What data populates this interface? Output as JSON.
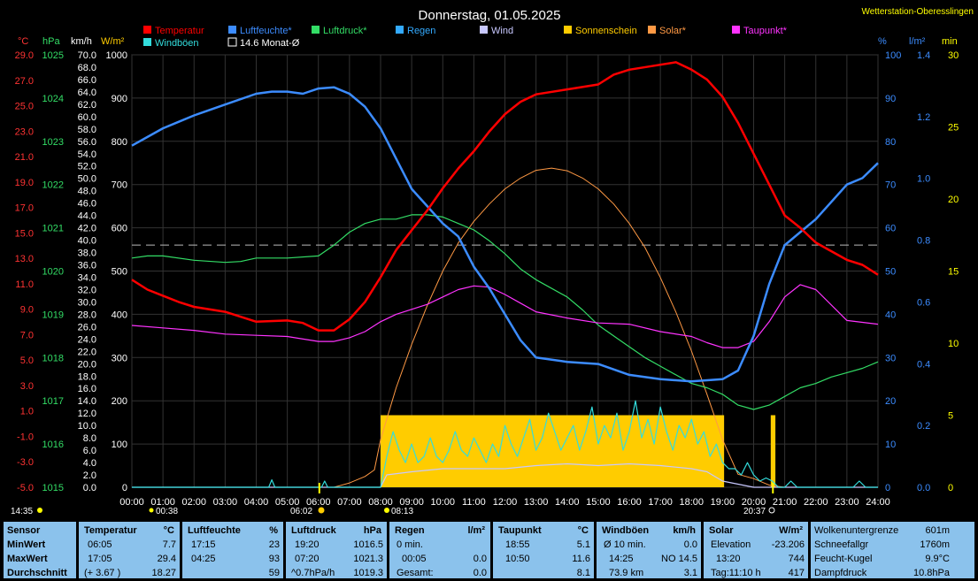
{
  "title": "Donnerstag, 01.05.2025",
  "station": "Wetterstation-Oberesslingen",
  "axes": {
    "left_units": [
      "°C",
      "hPa",
      "km/h",
      "W/m²"
    ],
    "right_units": [
      "%",
      "l/m²",
      "min"
    ],
    "temp_ticks": [
      "29.0",
      "27.0",
      "25.0",
      "23.0",
      "21.0",
      "19.0",
      "17.0",
      "15.0",
      "13.0",
      "11.0",
      "9.0",
      "7.0",
      "5.0",
      "3.0",
      "1.0",
      "-1.0",
      "-3.0",
      "-5.0"
    ],
    "hpa_ticks": [
      "1025",
      "1024",
      "1023",
      "1022",
      "1021",
      "1020",
      "1019",
      "1018",
      "1017",
      "1016",
      "1015"
    ],
    "kmh_ticks": [
      "70.0",
      "68.0",
      "66.0",
      "64.0",
      "62.0",
      "60.0",
      "58.0",
      "56.0",
      "54.0",
      "52.0",
      "50.0",
      "48.0",
      "46.0",
      "44.0",
      "42.0",
      "40.0",
      "38.0",
      "36.0",
      "34.0",
      "32.0",
      "30.0",
      "28.0",
      "26.0",
      "24.0",
      "22.0",
      "20.0",
      "18.0",
      "16.0",
      "14.0",
      "12.0",
      "10.0",
      "8.0",
      "6.0",
      "4.0",
      "2.0",
      "0.0"
    ],
    "wm2_ticks": [
      "1000",
      "900",
      "800",
      "700",
      "600",
      "500",
      "400",
      "300",
      "200",
      "100",
      "0"
    ],
    "pct_ticks": [
      "100",
      "90",
      "80",
      "70",
      "60",
      "50",
      "40",
      "30",
      "20",
      "10",
      "0"
    ],
    "lm2_ticks": [
      "1.4",
      "1.2",
      "1.0",
      "0.8",
      "0.6",
      "0.4",
      "0.2",
      "0.0"
    ],
    "min_ticks": [
      "30",
      "25",
      "20",
      "15",
      "10",
      "5",
      "0"
    ],
    "x_ticks": [
      "00:00",
      "01:00",
      "02:00",
      "03:00",
      "04:00",
      "05:00",
      "06:00",
      "07:00",
      "08:00",
      "09:00",
      "10:00",
      "11:00",
      "12:00",
      "13:00",
      "14:00",
      "15:00",
      "16:00",
      "17:00",
      "18:00",
      "19:00",
      "20:00",
      "21:00",
      "22:00",
      "23:00",
      "24:00"
    ]
  },
  "legend": [
    {
      "label": "Temperatur",
      "color": "#ff0000"
    },
    {
      "label": "Luftfeuchte*",
      "color": "#3c8cff"
    },
    {
      "label": "Luftdruck*",
      "color": "#33dd66"
    },
    {
      "label": "Regen",
      "color": "#33aaff"
    },
    {
      "label": "Wind",
      "color": "#c8c8ff"
    },
    {
      "label": "Sonnenschein",
      "color": "#ffcc00"
    },
    {
      "label": "Solar*",
      "color": "#ff9944"
    },
    {
      "label": "Taupunkt*",
      "color": "#ff33ff"
    },
    {
      "label": "Windböen",
      "color": "#33dddd"
    },
    {
      "label": "14.6 Monat-Ø",
      "color": "#000000"
    }
  ],
  "markers": {
    "moonrise": "14:35",
    "moonset_time": "00:38",
    "sunrise": "06:02",
    "sunset": "20:37",
    "civil": "08:13"
  },
  "chart_data": {
    "type": "line",
    "x_unit": "hours",
    "xlim": [
      0,
      24
    ],
    "series": [
      {
        "name": "Temperatur",
        "unit": "°C",
        "color": "#ff0000",
        "x": [
          0,
          0.5,
          1,
          1.5,
          2,
          3,
          4,
          5,
          5.5,
          6,
          6.5,
          7,
          7.5,
          8,
          8.5,
          9,
          9.5,
          10,
          10.5,
          11,
          11.5,
          12,
          12.5,
          13,
          14,
          15,
          15.5,
          16,
          17,
          17.5,
          18,
          18.5,
          19,
          19.5,
          20,
          20.5,
          21,
          21.5,
          22,
          23,
          23.5,
          24
        ],
        "y": [
          11.8,
          11,
          10.5,
          10,
          9.6,
          9.2,
          8.4,
          8.5,
          8.3,
          7.7,
          7.7,
          8.6,
          10,
          12,
          14.2,
          15.8,
          17.4,
          19.2,
          20.8,
          22.2,
          23.8,
          25.2,
          26.2,
          26.8,
          27.2,
          27.6,
          28.4,
          28.8,
          29.2,
          29.4,
          28.8,
          28,
          26.6,
          24.5,
          22,
          19.5,
          17,
          16,
          14.8,
          13.4,
          13,
          12.2
        ]
      },
      {
        "name": "Luftfeuchte*",
        "unit": "%",
        "color": "#3c8cff",
        "x": [
          0,
          0.5,
          1,
          1.5,
          2,
          3,
          4,
          4.5,
          5,
          5.5,
          6,
          6.5,
          7,
          7.5,
          8,
          8.5,
          9,
          9.5,
          10,
          10.5,
          11,
          11.5,
          12,
          12.5,
          13,
          14,
          15,
          16,
          17,
          18,
          19,
          19.5,
          20,
          20.5,
          21,
          21.5,
          22,
          23,
          23.5,
          24
        ],
        "y": [
          79,
          81,
          83,
          84.5,
          86,
          88.5,
          91,
          91.5,
          91.5,
          91,
          92.2,
          92.5,
          91,
          88,
          83,
          76,
          69,
          65,
          61,
          58,
          51,
          46,
          40,
          34,
          30,
          29,
          28.5,
          26,
          25,
          24.5,
          25,
          27,
          35,
          47,
          56,
          59,
          62,
          70,
          71.5,
          75
        ]
      },
      {
        "name": "Luftdruck*",
        "unit": "hPa",
        "color": "#33dd66",
        "x": [
          0,
          0.5,
          1,
          2,
          3,
          3.5,
          4,
          4.5,
          5,
          6,
          6.5,
          7,
          7.5,
          8,
          8.5,
          9,
          9.5,
          10,
          10.5,
          11,
          11.5,
          12,
          12.5,
          13,
          14,
          14.5,
          15,
          15.5,
          16,
          16.5,
          17,
          17.5,
          18,
          18.5,
          19,
          19.5,
          20,
          20.5,
          21,
          21.5,
          22,
          22.5,
          23,
          23.5,
          24
        ],
        "y": [
          1020.3,
          1020.35,
          1020.35,
          1020.25,
          1020.2,
          1020.22,
          1020.3,
          1020.3,
          1020.3,
          1020.35,
          1020.6,
          1020.9,
          1021.1,
          1021.2,
          1021.2,
          1021.3,
          1021.3,
          1021.25,
          1021.1,
          1020.95,
          1020.7,
          1020.4,
          1020.05,
          1019.8,
          1019.4,
          1019.1,
          1018.75,
          1018.5,
          1018.25,
          1018.0,
          1017.8,
          1017.6,
          1017.4,
          1017.3,
          1017.15,
          1016.9,
          1016.8,
          1016.9,
          1017.1,
          1017.3,
          1017.4,
          1017.55,
          1017.65,
          1017.75,
          1017.9
        ]
      },
      {
        "name": "Taupunkt*",
        "unit": "°C",
        "color": "#ff33ff",
        "x": [
          0,
          1,
          2,
          3,
          4,
          5,
          6,
          6.5,
          7,
          7.5,
          8,
          8.5,
          9,
          9.5,
          10,
          10.5,
          11,
          11.5,
          12,
          12.5,
          13,
          14,
          15,
          16,
          17,
          18,
          18.5,
          19,
          19.5,
          20,
          20.5,
          21,
          21.5,
          22,
          23,
          24
        ],
        "y": [
          8.1,
          7.9,
          7.7,
          7.4,
          7.3,
          7.2,
          6.8,
          6.8,
          7.1,
          7.6,
          8.4,
          9.0,
          9.4,
          9.8,
          10.4,
          11.0,
          11.3,
          11.2,
          10.6,
          9.9,
          9.2,
          8.7,
          8.3,
          8.2,
          7.6,
          7.2,
          6.7,
          6.3,
          6.3,
          6.8,
          8.4,
          10.4,
          11.4,
          11.0,
          8.5,
          8.2
        ]
      },
      {
        "name": "Solar*",
        "unit": "W/m²",
        "color": "#ff9944",
        "x": [
          0,
          6.5,
          7,
          7.5,
          7.8,
          8,
          8.5,
          9,
          9.5,
          10,
          10.5,
          11,
          11.5,
          12,
          12.5,
          13,
          13.5,
          14,
          14.5,
          15,
          15.5,
          16,
          16.5,
          17,
          17.5,
          18,
          18.5,
          19,
          19.5,
          20,
          20.5,
          21,
          24
        ],
        "y": [
          0,
          0,
          10,
          25,
          40,
          110,
          230,
          330,
          420,
          500,
          565,
          615,
          655,
          690,
          715,
          733,
          738,
          732,
          715,
          690,
          655,
          610,
          555,
          485,
          405,
          315,
          215,
          110,
          30,
          20,
          5,
          0,
          0
        ]
      },
      {
        "name": "Windböen",
        "unit": "km/h",
        "color": "#33dddd",
        "x": [
          0,
          4.4,
          4.5,
          4.6,
          6.1,
          6.2,
          6.3,
          8.0,
          8.2,
          8.4,
          8.6,
          8.8,
          9,
          9.2,
          9.4,
          9.6,
          9.8,
          10,
          10.2,
          10.4,
          10.6,
          10.8,
          11,
          11.2,
          11.4,
          11.6,
          11.8,
          12,
          12.2,
          12.4,
          12.6,
          12.8,
          13,
          13.2,
          13.4,
          13.6,
          13.8,
          14,
          14.2,
          14.4,
          14.6,
          14.8,
          15,
          15.2,
          15.4,
          15.6,
          15.8,
          16,
          16.2,
          16.4,
          16.6,
          16.8,
          17,
          17.2,
          17.4,
          17.6,
          17.8,
          18,
          18.2,
          18.4,
          18.6,
          18.8,
          19,
          19.2,
          19.4,
          19.6,
          19.8,
          20,
          20.2,
          20.4,
          20.6,
          20.8,
          21,
          21.2,
          21.4,
          22,
          23.2,
          23.4,
          23.6,
          24
        ],
        "y": [
          0,
          0,
          1.2,
          0,
          0,
          1.0,
          0,
          0,
          5,
          9,
          6,
          4,
          7,
          4,
          5,
          8,
          5,
          4,
          6,
          9,
          6,
          5,
          8,
          6,
          4,
          7,
          5,
          10,
          7,
          5,
          8,
          11,
          6,
          8,
          12,
          9,
          6,
          8,
          10,
          6,
          9,
          13,
          7,
          10,
          8,
          12,
          6,
          9,
          14,
          8,
          11,
          7,
          13,
          9,
          6,
          10,
          8,
          11,
          7,
          9,
          5,
          7,
          4,
          3,
          3,
          2,
          4,
          2,
          1,
          1.5,
          1,
          0,
          0,
          1,
          0,
          0,
          0,
          1,
          0,
          0
        ]
      },
      {
        "name": "Wind",
        "unit": "km/h",
        "color": "#c8c8ff",
        "x": [
          0,
          8,
          8.2,
          9,
          10,
          11,
          12,
          13,
          14,
          15,
          16,
          17,
          18,
          18.5,
          19,
          20,
          24
        ],
        "y": [
          0,
          0,
          2,
          2.5,
          3,
          3,
          3,
          3.5,
          3.8,
          3.5,
          3.8,
          3.5,
          3,
          2.5,
          1,
          0,
          0
        ]
      },
      {
        "name": "Sonnenschein",
        "unit": "min",
        "color": "#ffcc00",
        "type": "bar",
        "x": [
          8.0,
          19.05,
          20.55,
          20.7
        ],
        "y": [
          5,
          0,
          5,
          0
        ]
      }
    ],
    "ylim_temp": [
      -5,
      30
    ],
    "ylim_hpa": [
      1015,
      1025
    ],
    "ylim_kmh": [
      0,
      70
    ],
    "ylim_wm2": [
      0,
      1000
    ],
    "ylim_pct": [
      0,
      100
    ],
    "monthly_avg_temp": 14.6
  },
  "panel": {
    "sensor": {
      "title": "Sensor",
      "rows": [
        "MinWert",
        "MaxWert",
        "Durchschnitt"
      ]
    },
    "temp": {
      "title": "Temperatur",
      "unit": "°C",
      "rows": [
        [
          "06:05",
          "7.7"
        ],
        [
          "17:05",
          "29.4"
        ],
        [
          "(+ 3.67 )",
          "18.27"
        ]
      ]
    },
    "hum": {
      "title": "Luftfeuchte",
      "unit": "%",
      "rows": [
        [
          "17:15",
          "23"
        ],
        [
          "04:25",
          "93"
        ],
        [
          "",
          "59"
        ]
      ]
    },
    "press": {
      "title": "Luftdruck",
      "unit": "hPa",
      "rows": [
        [
          "19:20",
          "1016.5"
        ],
        [
          "07:20",
          "1021.3"
        ],
        [
          "^0.7hPa/h",
          "1019.3"
        ]
      ]
    },
    "rain": {
      "title": "Regen",
      "unit": "l/m²",
      "rows": [
        [
          "0 min.",
          ""
        ],
        [
          "00:05",
          "0.0"
        ],
        [
          "Gesamt:",
          "0.0"
        ]
      ]
    },
    "dew": {
      "title": "Taupunkt",
      "unit": "°C",
      "rows": [
        [
          "18:55",
          "5.1"
        ],
        [
          "10:50",
          "11.6"
        ],
        [
          "",
          "8.1"
        ]
      ]
    },
    "wind": {
      "title": "Windböen",
      "unit": "km/h",
      "rows": [
        [
          "Ø 10 min.",
          "0.0"
        ],
        [
          "14:25",
          "NO 14.5"
        ],
        [
          "73.9 km",
          "3.1"
        ]
      ]
    },
    "solar": {
      "title": "Solar",
      "unit": "W/m²",
      "rows": [
        [
          "Elevation",
          "-23.206"
        ],
        [
          "13:20",
          "744"
        ],
        [
          "Tag:11:10 h",
          "417"
        ]
      ]
    },
    "misc": {
      "rows": [
        [
          "Wolkenuntergrenze",
          "601m"
        ],
        [
          "Schneefallgr",
          "1760m"
        ],
        [
          "Feucht-Kugel",
          "9.9°C"
        ],
        [
          "Dampfdruck",
          "10.8hPa"
        ]
      ]
    }
  }
}
